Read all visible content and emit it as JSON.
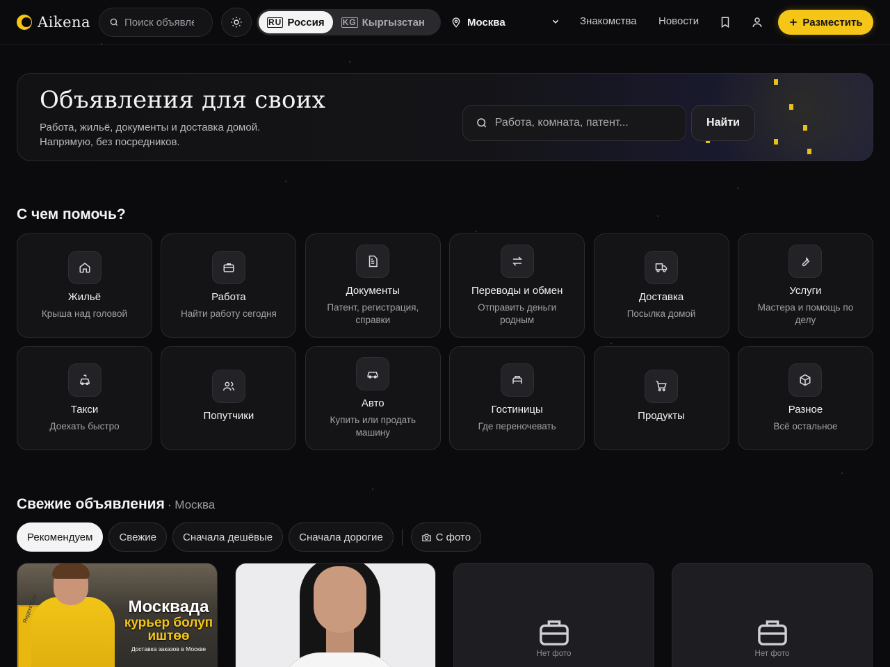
{
  "header": {
    "logo_text": "Aikena",
    "search_placeholder": "Поиск объявлений",
    "countries": [
      {
        "flag": "RU",
        "label": "Россия",
        "active": true
      },
      {
        "flag": "KG",
        "label": "Кыргызстан",
        "active": false
      }
    ],
    "city": "Москва",
    "nav": [
      "Знакомства",
      "Новости"
    ],
    "post_label": "Разместить"
  },
  "hero": {
    "title": "Объявления для своих",
    "subtitle": "Работа, жильё, документы и доставка домой. Напрямую, без посредников.",
    "search_placeholder": "Работа, комната, патент...",
    "search_button": "Найти"
  },
  "categories": {
    "title": "С чем помочь?",
    "items": [
      {
        "icon": "home-icon",
        "title": "Жильё",
        "desc": "Крыша над головой"
      },
      {
        "icon": "briefcase-icon",
        "title": "Работа",
        "desc": "Найти работу сегодня"
      },
      {
        "icon": "document-icon",
        "title": "Документы",
        "desc": "Патент, регистрация, справки"
      },
      {
        "icon": "exchange-icon",
        "title": "Переводы и обмен",
        "desc": "Отправить деньги родным"
      },
      {
        "icon": "truck-icon",
        "title": "Доставка",
        "desc": "Посылка домой"
      },
      {
        "icon": "wrench-icon",
        "title": "Услуги",
        "desc": "Мастера и помощь по делу"
      },
      {
        "icon": "taxi-icon",
        "title": "Такси",
        "desc": "Доехать быстро"
      },
      {
        "icon": "users-icon",
        "title": "Попутчики",
        "desc": ""
      },
      {
        "icon": "car-icon",
        "title": "Авто",
        "desc": "Купить или продать машину"
      },
      {
        "icon": "bed-icon",
        "title": "Гостиницы",
        "desc": "Где переночевать"
      },
      {
        "icon": "cart-icon",
        "title": "Продукты",
        "desc": ""
      },
      {
        "icon": "box-icon",
        "title": "Разное",
        "desc": "Всё остальное"
      }
    ]
  },
  "listings": {
    "title": "Свежие объявления",
    "city_suffix": "· Москва",
    "sort": [
      "Рекомендуем",
      "Свежие",
      "Сначала дешёвые",
      "Сначала дорогие"
    ],
    "photo_filter": "С фото",
    "cards": [
      {
        "type": "photo-courier",
        "ad_line1": "Москвада",
        "ad_line2": "курьер болуп иштөө",
        "ad_line3": "Доставка заказов в Москве",
        "ad_tag": "Яндекс Еда"
      },
      {
        "type": "photo-portrait"
      },
      {
        "type": "nophoto",
        "label": "Нет фото"
      },
      {
        "type": "nophoto",
        "label": "Нет фото"
      }
    ]
  },
  "colors": {
    "accent": "#f5c518",
    "background": "#0b0b0d",
    "card": "#141417"
  }
}
